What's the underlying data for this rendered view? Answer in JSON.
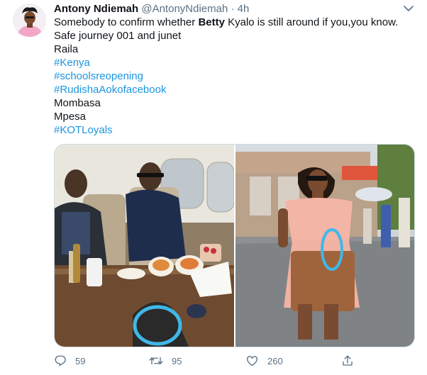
{
  "tweet": {
    "author_name": "Antony Ndiemah",
    "handle": "@AntonyNdiemah",
    "separator": "·",
    "time": "4h",
    "lines": [
      {
        "before": "Somebody to confirm whether ",
        "bold": "Betty",
        "after": " Kyalo is still around if you,you know."
      },
      {
        "text": "Safe journey 001 and junet"
      },
      {
        "text": "Raila"
      },
      {
        "text": "#Kenya",
        "hashtag": true
      },
      {
        "text": "#schoolsreopening",
        "hashtag": true
      },
      {
        "text": "#RudishaAokofacebook",
        "hashtag": true
      },
      {
        "text": "Mombasa"
      },
      {
        "text": "Mpesa"
      },
      {
        "text": "#KOTLoyals",
        "hashtag": true
      }
    ]
  },
  "actions": {
    "reply": {
      "icon": "reply-icon",
      "count": "59"
    },
    "retweet": {
      "icon": "retweet-icon",
      "count": "95"
    },
    "like": {
      "icon": "heart-icon",
      "count": "260"
    },
    "share": {
      "icon": "share-icon"
    }
  },
  "colors": {
    "hashtag": "#1b95e0",
    "secondary_text": "#5b7083",
    "annotation_circle": "#3fb8e8"
  }
}
